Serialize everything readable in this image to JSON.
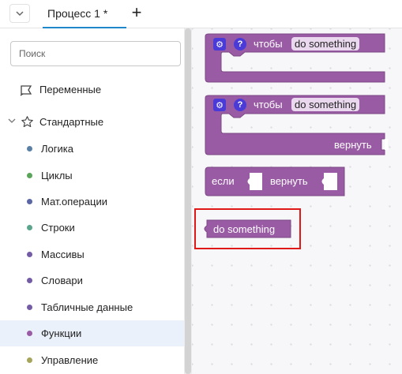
{
  "tabs": [
    {
      "label": "Процесс 1 *"
    }
  ],
  "tab_add_label": "+",
  "search": {
    "placeholder": "Поиск"
  },
  "categories": [
    {
      "label": "Переменные"
    },
    {
      "label": "Стандартные"
    },
    {
      "label": "Логика",
      "color": "#5b80a5"
    },
    {
      "label": "Циклы",
      "color": "#5ba55b"
    },
    {
      "label": "Мат.операции",
      "color": "#5b67a5"
    },
    {
      "label": "Строки",
      "color": "#5ba58c"
    },
    {
      "label": "Массивы",
      "color": "#745ba5"
    },
    {
      "label": "Словари",
      "color": "#745ba5"
    },
    {
      "label": "Табличные данные",
      "color": "#745ba5"
    },
    {
      "label": "Функции",
      "color": "#9a5ba5"
    },
    {
      "label": "Управление",
      "color": "#a5a55b"
    }
  ],
  "selected_category": "Функции",
  "blocks": {
    "proc_noreturn": {
      "kw": "чтобы",
      "name": "do something"
    },
    "proc_return": {
      "kw": "чтобы",
      "name": "do something",
      "return": "вернуть"
    },
    "ifreturn": {
      "if": "если",
      "return": "вернуть"
    },
    "call": {
      "name": "do something"
    }
  },
  "colors": {
    "block": "#9a5ba5",
    "block_dark": "#7b4984",
    "accent": "#1e88c8",
    "highlight": "#e01818"
  }
}
